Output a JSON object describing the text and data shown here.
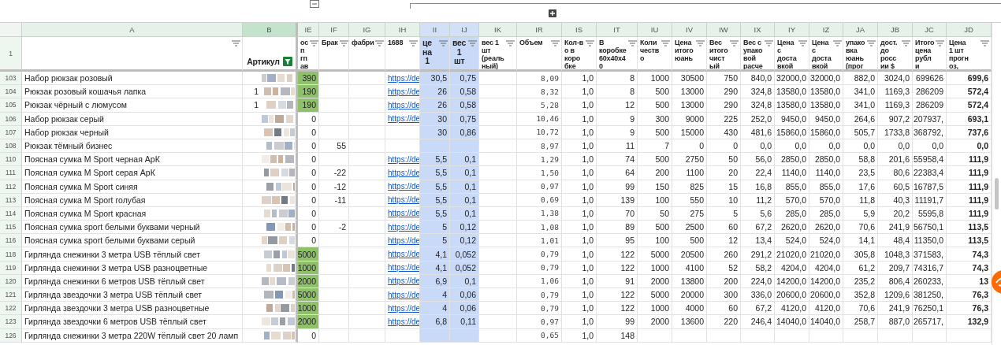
{
  "header_row_number": "1",
  "columns": [
    {
      "letter": "A",
      "filter_active": false,
      "selected": false
    },
    {
      "letter": "B",
      "header": "Артикул",
      "filter_active": true,
      "selected": false
    },
    {
      "letter": "IE",
      "header": "ос\nп\nгп\nав",
      "filter_active": false,
      "selected": false
    },
    {
      "letter": "IF",
      "header": "Брак",
      "filter_active": false,
      "selected": false
    },
    {
      "letter": "IG",
      "header": "фабри",
      "filter_active": false,
      "selected": false
    },
    {
      "letter": "IH",
      "header": "1688",
      "filter_active": false,
      "selected": false
    },
    {
      "letter": "II",
      "header": "це\nна\n1",
      "filter_active": false,
      "selected": true
    },
    {
      "letter": "IJ",
      "header": "вес\n1\nшт",
      "filter_active": false,
      "selected": true
    },
    {
      "letter": "IK",
      "header": "вес 1\nшт\n(реаль\nный)",
      "filter_active": false,
      "selected": false
    },
    {
      "letter": "IR",
      "header": "Объем",
      "filter_active": false,
      "selected": false
    },
    {
      "letter": "IS",
      "header": "Кол-в\nо в\nкоро\nбке",
      "filter_active": false,
      "selected": false
    },
    {
      "letter": "IT",
      "header": "В\nкоробке\n60х40х4\n0",
      "filter_active": false,
      "selected": false
    },
    {
      "letter": "IU",
      "header": "Коли\nчеств\nо",
      "filter_active": false,
      "selected": false
    },
    {
      "letter": "IV",
      "header": "Цена\nитого\nюань",
      "filter_active": false,
      "selected": false
    },
    {
      "letter": "IW",
      "header": "Вес\nитого\nчист\nый",
      "filter_active": false,
      "selected": false
    },
    {
      "letter": "IX",
      "header": "Вес с\nупако\nвой\nрасче",
      "filter_active": false,
      "selected": false
    },
    {
      "letter": "IY",
      "header": "Цена\nс\nдоста\nвкой",
      "filter_active": false,
      "selected": false
    },
    {
      "letter": "IZ",
      "header": "Цена\nс\nдоста\nвкой",
      "filter_active": false,
      "selected": false
    },
    {
      "letter": "JA",
      "header": "упако\nвка\nюань\n(прог",
      "filter_active": false,
      "selected": false
    },
    {
      "letter": "JB",
      "header": "дост.\nдо\nросс\nии $",
      "filter_active": false,
      "selected": false
    },
    {
      "letter": "JC",
      "header": "Итого\nцена\nрубл\nи",
      "filter_active": false,
      "selected": false
    },
    {
      "letter": "JD",
      "header": "Цена\n1 шт\nпрогн\nоз,",
      "filter_active": false,
      "selected": false
    }
  ],
  "rows": [
    {
      "num": "103",
      "name": "Набор рюкзак розовый",
      "ie": "390",
      "ie_marked": true,
      "link": "https://de",
      "ii": "30,5",
      "ij": "0,75",
      "values": [
        "8,09",
        "1,0",
        "8",
        "1000",
        "30500",
        "750",
        "840,0",
        "32000,0",
        "32000,0",
        "882,0",
        "3024,0",
        "699626",
        "699,6"
      ]
    },
    {
      "num": "104",
      "name": "Рюкзак розовый кошачья лапка",
      "article": "1",
      "ie": "190",
      "ie_marked": true,
      "link": "https://de",
      "ii": "26",
      "ij": "0,58",
      "values": [
        "8,32",
        "1,0",
        "8",
        "500",
        "13000",
        "290",
        "324,8",
        "13580,0",
        "13580,0",
        "341,0",
        "1169,3",
        "286209",
        "572,4"
      ]
    },
    {
      "num": "105",
      "name": "Рюкзак чёрный с люмусом",
      "article": "1",
      "ie": "190",
      "ie_marked": true,
      "link": "https://de",
      "ii": "26",
      "ij": "0,58",
      "values": [
        "5,28",
        "1,0",
        "12",
        "500",
        "13000",
        "290",
        "324,8",
        "13580,0",
        "13580,0",
        "341,0",
        "1169,3",
        "286209",
        "572,4"
      ]
    },
    {
      "num": "106",
      "name": "Набор рюкзак серый",
      "ie": "0",
      "ie_marked": false,
      "link": "https://de",
      "ii": "30",
      "ij": "0,75",
      "values": [
        "10,46",
        "1,0",
        "9",
        "300",
        "9000",
        "225",
        "252,0",
        "9450,0",
        "9450,0",
        "264,6",
        "907,2",
        "207937,",
        "693,1"
      ]
    },
    {
      "num": "107",
      "name": "Набор рюкзак черный",
      "ie": "0",
      "ie_marked": false,
      "ii": "30",
      "ij": "0,86",
      "values": [
        "10,72",
        "1,0",
        "9",
        "500",
        "15000",
        "430",
        "481,6",
        "15860,0",
        "15860,0",
        "505,7",
        "1733,8",
        "368792,",
        "737,6"
      ]
    },
    {
      "num": "108",
      "name": "Рюкзак тёмный бизнес",
      "ie": "0",
      "ie_marked": false,
      "brak": "55",
      "values": [
        "8,97",
        "1,0",
        "11",
        "7",
        "0",
        "0",
        "0,0",
        "0,0",
        "0,0",
        "0,0",
        "0,0",
        "0,0",
        "0,0"
      ]
    },
    {
      "num": "110",
      "name": "Поясная сумка M Sport черная АрК",
      "ie": "0",
      "ie_marked": false,
      "link": "https://de",
      "ii": "5,5",
      "ij": "0,1",
      "values": [
        "1,29",
        "1,0",
        "74",
        "500",
        "2750",
        "50",
        "56,0",
        "2850,0",
        "2850,0",
        "58,8",
        "201,6",
        "55958,4",
        "111,9"
      ]
    },
    {
      "num": "111",
      "name": "Поясная сумка M Sport серая АрК",
      "ie": "0",
      "ie_marked": false,
      "brak": "-22",
      "link": "https://de",
      "ii": "5,5",
      "ij": "0,1",
      "values": [
        "1,50",
        "1,0",
        "64",
        "200",
        "1100",
        "20",
        "22,4",
        "1140,0",
        "1140,0",
        "23,5",
        "80,6",
        "22383,4",
        "111,9"
      ]
    },
    {
      "num": "112",
      "name": "Поясная сумка M Sport синяя",
      "ie": "0",
      "ie_marked": false,
      "brak": "-12",
      "link": "https://de",
      "ii": "5,5",
      "ij": "0,1",
      "values": [
        "0,97",
        "1,0",
        "99",
        "150",
        "825",
        "15",
        "16,8",
        "855,0",
        "855,0",
        "17,6",
        "60,5",
        "16787,5",
        "111,9"
      ]
    },
    {
      "num": "113",
      "name": "Поясная сумка M Sport голубая",
      "ie": "0",
      "ie_marked": false,
      "brak": "-11",
      "link": "https://de",
      "ii": "5,5",
      "ij": "0,1",
      "values": [
        "0,69",
        "1,0",
        "139",
        "100",
        "550",
        "10",
        "11,2",
        "570,0",
        "570,0",
        "11,8",
        "40,3",
        "11191,7",
        "111,9"
      ]
    },
    {
      "num": "114",
      "name": "Поясная сумка M Sport красная",
      "ie": "0",
      "ie_marked": false,
      "link": "https://de",
      "ii": "5,5",
      "ij": "0,1",
      "values": [
        "1,38",
        "1,0",
        "70",
        "50",
        "275",
        "5",
        "5,6",
        "285,0",
        "285,0",
        "5,9",
        "20,2",
        "5595,8",
        "111,9"
      ]
    },
    {
      "num": "115",
      "name": "Поясная сумка sport белыми буквами черный",
      "ie": "0",
      "ie_marked": false,
      "brak": "-2",
      "link": "https://de",
      "ii": "5",
      "ij": "0,12",
      "values": [
        "1,08",
        "1,0",
        "89",
        "500",
        "2500",
        "60",
        "67,2",
        "2620,0",
        "2620,0",
        "70,6",
        "241,9",
        "56750,1",
        "113,5"
      ]
    },
    {
      "num": "116",
      "name": "Поясная сумка sport белыми буквами серый",
      "ie": "0",
      "ie_marked": false,
      "link": "https://de",
      "ii": "5",
      "ij": "0,12",
      "values": [
        "1,01",
        "1,0",
        "95",
        "100",
        "500",
        "12",
        "13,4",
        "524,0",
        "524,0",
        "14,1",
        "48,4",
        "11350,0",
        "113,5"
      ]
    },
    {
      "num": "118",
      "name": "Гирлянда снежинки 3 метра USB тёплый свет",
      "ie": "5000",
      "ie_marked": true,
      "link": "https://de",
      "ii": "4,1",
      "ij": "0,052",
      "values": [
        "0,79",
        "1,0",
        "122",
        "5000",
        "20500",
        "260",
        "291,2",
        "21020,0",
        "21020,0",
        "305,8",
        "1048,3",
        "371583,",
        "74,3"
      ]
    },
    {
      "num": "119",
      "name": "Гирлянда снежинки 3 метра USB разноцветные",
      "ie": "1000",
      "ie_marked": true,
      "link": "https://de",
      "ii": "4,1",
      "ij": "0,052",
      "values": [
        "0,79",
        "1,0",
        "122",
        "1000",
        "4100",
        "52",
        "58,2",
        "4204,0",
        "4204,0",
        "61,2",
        "209,7",
        "74316,7",
        "74,3"
      ]
    },
    {
      "num": "120",
      "name": "Гирлянда снежинки 6 метров USB тёплый свет",
      "ie": "2000",
      "ie_marked": true,
      "link": "https://de",
      "ii": "6,9",
      "ij": "0,1",
      "values": [
        "1,06",
        "1,0",
        "91",
        "2000",
        "13800",
        "200",
        "224,0",
        "14200,0",
        "14200,0",
        "235,2",
        "806,4",
        "260233,",
        "13"
      ]
    },
    {
      "num": "121",
      "name": "Гирлянда звездочки 3 метра USB тёплый свет",
      "ie": "5000",
      "ie_marked": true,
      "link": "https://de",
      "ii": "4",
      "ij": "0,06",
      "values": [
        "0,79",
        "1,0",
        "122",
        "5000",
        "20000",
        "300",
        "336,0",
        "20600,0",
        "20600,0",
        "352,8",
        "1209,6",
        "381250,",
        "76,3"
      ]
    },
    {
      "num": "122",
      "name": "Гирлянда звездочки 3 метра USB разноцветные",
      "ie": "1000",
      "ie_marked": true,
      "link": "https://de",
      "ii": "4",
      "ij": "0,06",
      "values": [
        "0,79",
        "1,0",
        "122",
        "1000",
        "4000",
        "60",
        "67,2",
        "4120,0",
        "4120,0",
        "70,6",
        "241,9",
        "76250,1",
        "76,3"
      ]
    },
    {
      "num": "123",
      "name": "Гирлянда звездочки 6 метров USB тёплый свет",
      "ie": "2000",
      "ie_marked": true,
      "link": "https://de",
      "ii": "6,8",
      "ij": "0,11",
      "values": [
        "0,97",
        "1,0",
        "99",
        "2000",
        "13600",
        "220",
        "246,4",
        "14040,0",
        "14040,0",
        "258,7",
        "887,0",
        "265717,",
        "132,9"
      ]
    },
    {
      "num": "126",
      "name": "Гирлянда снежинки 3 метра 220W тёплый свет 20 ламп",
      "ie": "0",
      "ie_marked": false,
      "values": [
        "0,65",
        "1,0",
        "148"
      ]
    }
  ]
}
